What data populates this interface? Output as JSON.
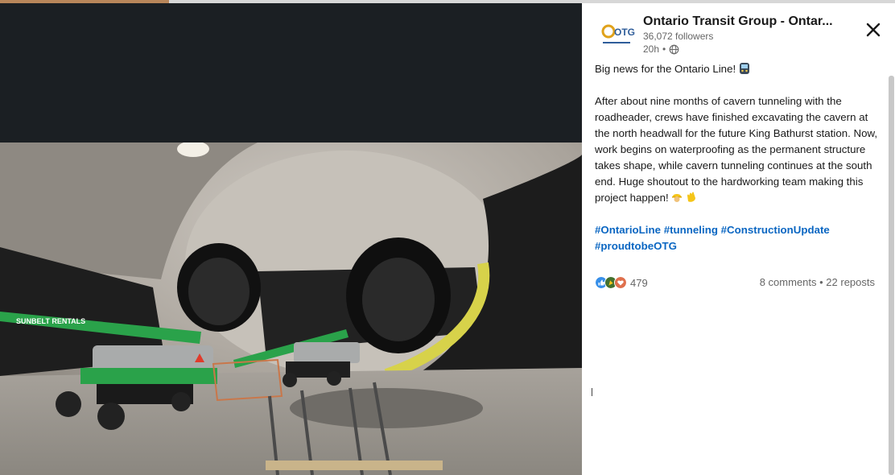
{
  "author": {
    "name": "Ontario Transit Group - Ontar...",
    "followers": "36,072 followers",
    "time": "20h",
    "separator": "•",
    "logo_text": "OTG"
  },
  "post": {
    "intro": "Big news for the Ontario Line!",
    "body": "After about nine months of cavern tunneling with the roadheader, crews have finished excavating the cavern at the north headwall for the future King Bathurst station. Now, work begins on waterproofing as the permanent structure takes shape, while cavern tunneling continues at the south end. Huge shoutout to the hardworking team making this project happen!",
    "hashtags": [
      "#OntarioLine",
      "#tunneling",
      "#ConstructionUpdate",
      "#proudtobeOTG"
    ]
  },
  "social": {
    "reaction_count": "479",
    "comments_reposts": "8 comments • 22 reposts"
  },
  "icons": {
    "close": "close-icon",
    "globe": "globe-icon",
    "train": "train-emoji",
    "worker": "construction-worker-emoji",
    "clap": "clapping-hands-emoji"
  },
  "colors": {
    "link": "#0a66c2",
    "text": "#191919",
    "muted": "#666666",
    "media_background": "#1b1f23"
  }
}
